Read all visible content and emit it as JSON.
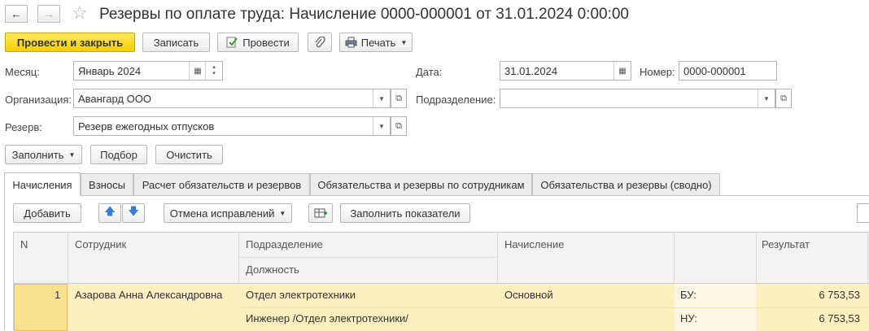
{
  "window": {
    "title": "Резервы по оплате труда: Начисление 0000-000001 от 31.01.2024 0:00:00",
    "back": "←",
    "forward": "→",
    "favorite": "☆"
  },
  "toolbar": {
    "post_close": "Провести и закрыть",
    "save": "Записать",
    "post": "Провести",
    "print": "Печать"
  },
  "fields": {
    "month_label": "Месяц:",
    "month_value": "Январь 2024",
    "date_label": "Дата:",
    "date_value": "31.01.2024",
    "number_label": "Номер:",
    "number_value": "0000-000001",
    "org_label": "Организация:",
    "org_value": "Авангард ООО",
    "dept_label": "Подразделение:",
    "dept_value": "",
    "reserve_label": "Резерв:",
    "reserve_value": "Резерв ежегодных отпусков"
  },
  "actions": {
    "fill": "Заполнить",
    "select": "Подбор",
    "clear": "Очистить"
  },
  "tabs": [
    {
      "label": "Начисления"
    },
    {
      "label": "Взносы"
    },
    {
      "label": "Расчет обязательств и резервов"
    },
    {
      "label": "Обязательства и резервы по сотрудникам"
    },
    {
      "label": "Обязательства и резервы (сводно)"
    }
  ],
  "grid_toolbar": {
    "add": "Добавить",
    "undo_fix": "Отмена исправлений",
    "fill_indicators": "Заполнить показатели"
  },
  "table": {
    "headers": {
      "n": "N",
      "employee": "Сотрудник",
      "department": "Подразделение",
      "position": "Должность",
      "accrual": "Начисление",
      "result": "Результат"
    },
    "rows": [
      {
        "n": "1",
        "employee": "Азарова Анна Александровна",
        "department": "Отдел электротехники",
        "position": "Инженер /Отдел электротехники/",
        "accrual": "Основной",
        "bu_label": "БУ:",
        "bu_value": "6 753,53",
        "nu_label": "НУ:",
        "nu_value": "6 753,53"
      }
    ]
  },
  "colors": {
    "primary_button": "#f5cf00",
    "selected_row": "#fbefc0",
    "selected_cell": "#f9e08f"
  }
}
